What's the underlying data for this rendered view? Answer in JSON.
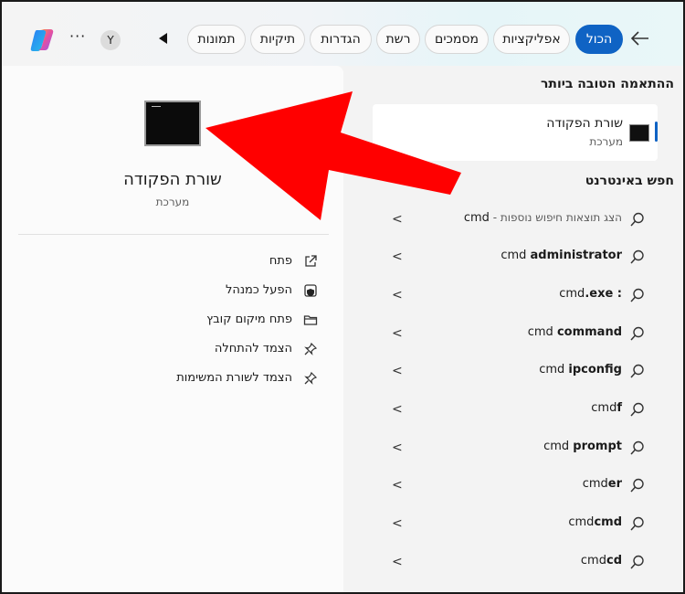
{
  "tabs": [
    {
      "label": "הכול",
      "active": true
    },
    {
      "label": "אפליקציות"
    },
    {
      "label": "מסמכים"
    },
    {
      "label": "רשת"
    },
    {
      "label": "הגדרות"
    },
    {
      "label": "תיקיות"
    },
    {
      "label": "תמונות"
    }
  ],
  "account": {
    "initial": "Y"
  },
  "more_label": "···",
  "best_match": {
    "heading": "ההתאמה הטובה ביותר",
    "title": "שורת הפקודה",
    "subtitle": "מערכת"
  },
  "web": {
    "heading": "חפש באינטרנט",
    "first": {
      "prefix": "cmd",
      "hint": " - הצג תוצאות חיפוש נוספות"
    },
    "suggestions": [
      {
        "base": "cmd ",
        "bold": "administrator"
      },
      {
        "base": "cmd",
        "bold": ".exe :"
      },
      {
        "base": "cmd ",
        "bold": "command"
      },
      {
        "base": "cmd ",
        "bold": "ipconfig"
      },
      {
        "base": "cmd",
        "bold": "f"
      },
      {
        "base": "cmd ",
        "bold": "prompt"
      },
      {
        "base": "cmd",
        "bold": "er"
      },
      {
        "base": "cmd",
        "bold": "cmd"
      },
      {
        "base": "cmd",
        "bold": "cd"
      }
    ]
  },
  "detail": {
    "title": "שורת הפקודה",
    "subtitle": "מערכת",
    "actions": [
      {
        "label": "פתח",
        "icon": "open-external-icon"
      },
      {
        "label": "הפעל כמנהל",
        "icon": "admin-shield-icon"
      },
      {
        "label": "פתח מיקום קובץ",
        "icon": "folder-icon"
      },
      {
        "label": "הצמד להתחלה",
        "icon": "pin-icon"
      },
      {
        "label": "הצמד לשורת המשימות",
        "icon": "pin-icon"
      }
    ]
  },
  "colors": {
    "accent": "#0f63c4",
    "arrow": "#ff0000"
  }
}
